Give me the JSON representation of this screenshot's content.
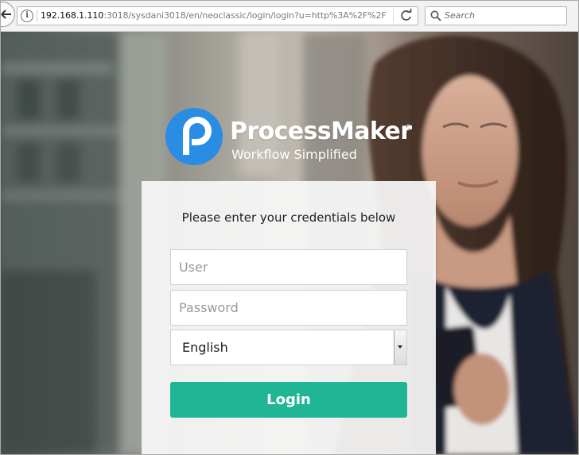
{
  "browser": {
    "url_host": "192.168.1.110",
    "url_rest": ":3018/sysdani3018/en/neoclassic/login/login?u=http%3A%2F%2F",
    "search_placeholder": "Search",
    "icons": [
      "back-arrow-icon",
      "info-icon",
      "reload-icon",
      "search-icon"
    ]
  },
  "brand": {
    "name": "ProcessMaker",
    "registered": "®",
    "tagline": "Workflow Simplified",
    "logo_color": "#2b8ce3"
  },
  "login": {
    "title": "Please enter your credentials below",
    "user_placeholder": "User",
    "password_placeholder": "Password",
    "language_selected": "English",
    "button_label": "Login",
    "button_color": "#1fb595"
  }
}
